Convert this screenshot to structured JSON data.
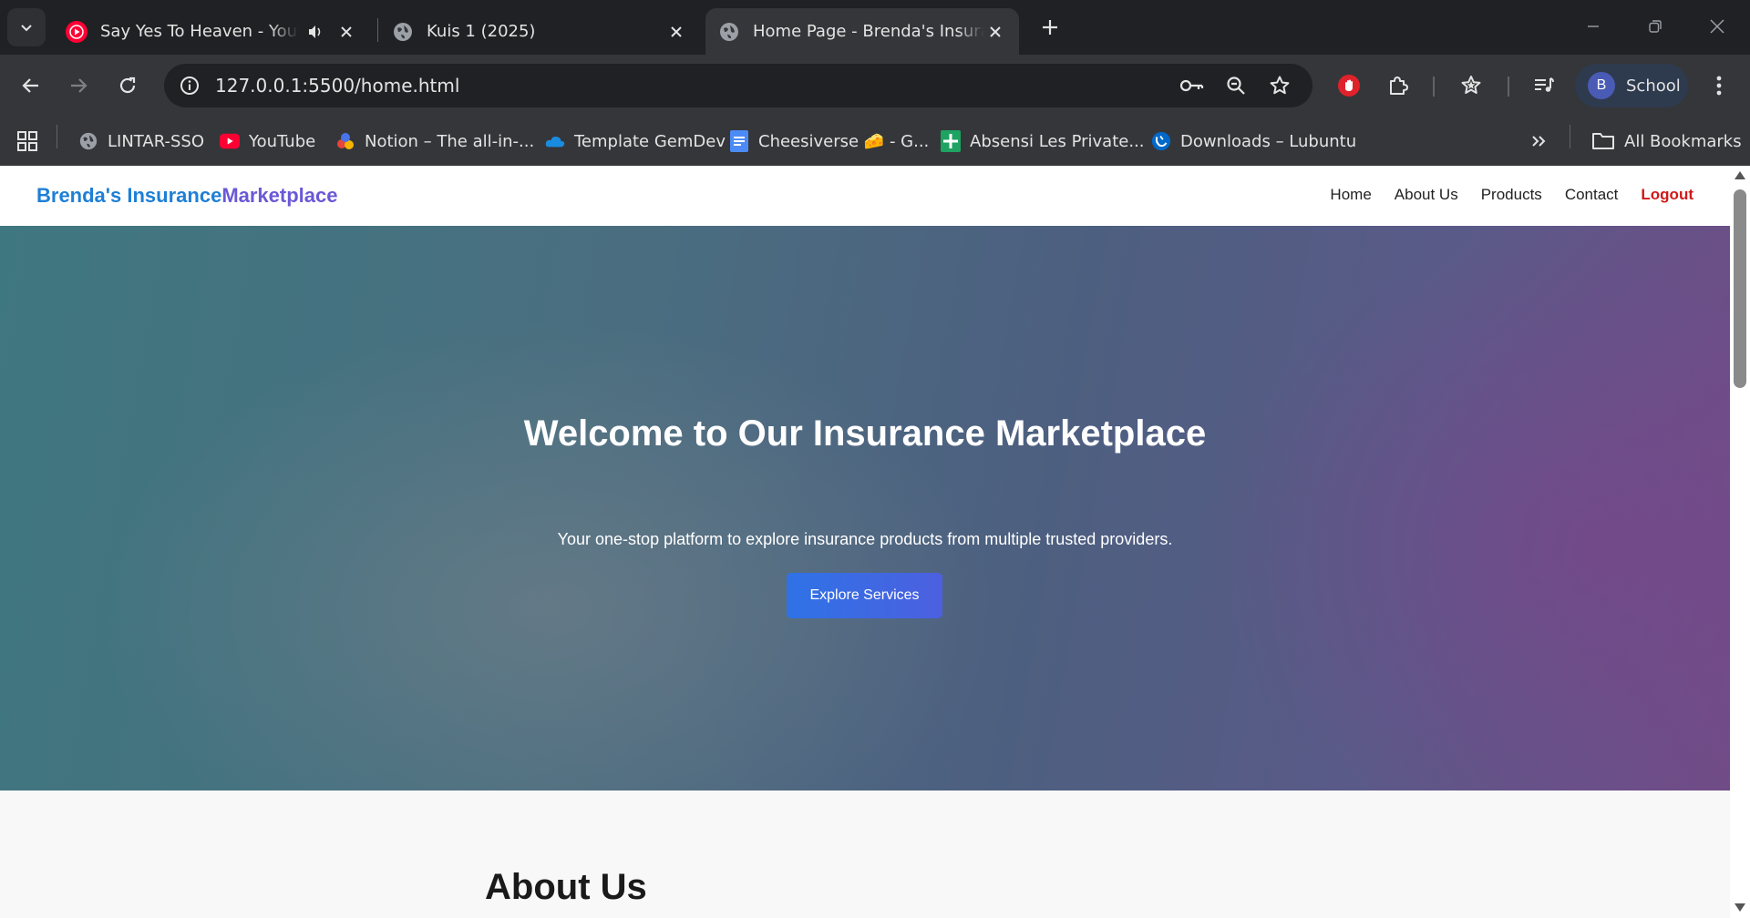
{
  "browser": {
    "tabs": [
      {
        "title": "Say Yes To Heaven - YouTube",
        "icon": "youtube-icon",
        "audio": true,
        "active": false
      },
      {
        "title": "Kuis 1 (2025)",
        "icon": "globe-icon",
        "active": false
      },
      {
        "title": "Home Page - Brenda's Insurance",
        "icon": "globe-icon",
        "active": true
      }
    ],
    "address_bar": {
      "url": "127.0.0.1:5500/home.html"
    },
    "profile": {
      "initial": "B",
      "name": "School"
    },
    "bookmarks": [
      {
        "label": "LINTAR-SSO",
        "icon": "globe-icon"
      },
      {
        "label": "YouTube",
        "icon": "youtube-icon"
      },
      {
        "label": "Notion – The all-in-...",
        "icon": "notion-icon"
      },
      {
        "label": "Template GemDev",
        "icon": "cloud-icon"
      },
      {
        "label": "Cheesiverse 🧀 - G...",
        "icon": "docs-icon"
      },
      {
        "label": "Absensi Les Private...",
        "icon": "sheets-icon"
      },
      {
        "label": "Downloads – Lubuntu",
        "icon": "lubuntu-icon"
      }
    ],
    "all_bookmarks_label": "All Bookmarks"
  },
  "site": {
    "brand_part1": "Brenda's Insurance",
    "brand_part2": "Marketplace",
    "nav": [
      {
        "label": "Home"
      },
      {
        "label": "About Us"
      },
      {
        "label": "Products"
      },
      {
        "label": "Contact"
      },
      {
        "label": "Logout"
      }
    ],
    "hero": {
      "title": "Welcome to Our Insurance Marketplace",
      "subtitle": "Your one-stop platform to explore insurance products from multiple trusted providers.",
      "button_label": "Explore Services"
    },
    "about": {
      "title": "About Us"
    }
  },
  "colors": {
    "brand_blue": "#1e7fd6",
    "brand_purple": "#6a58d6",
    "logout_red": "#d01919",
    "button_blue": "#2f72e6"
  }
}
